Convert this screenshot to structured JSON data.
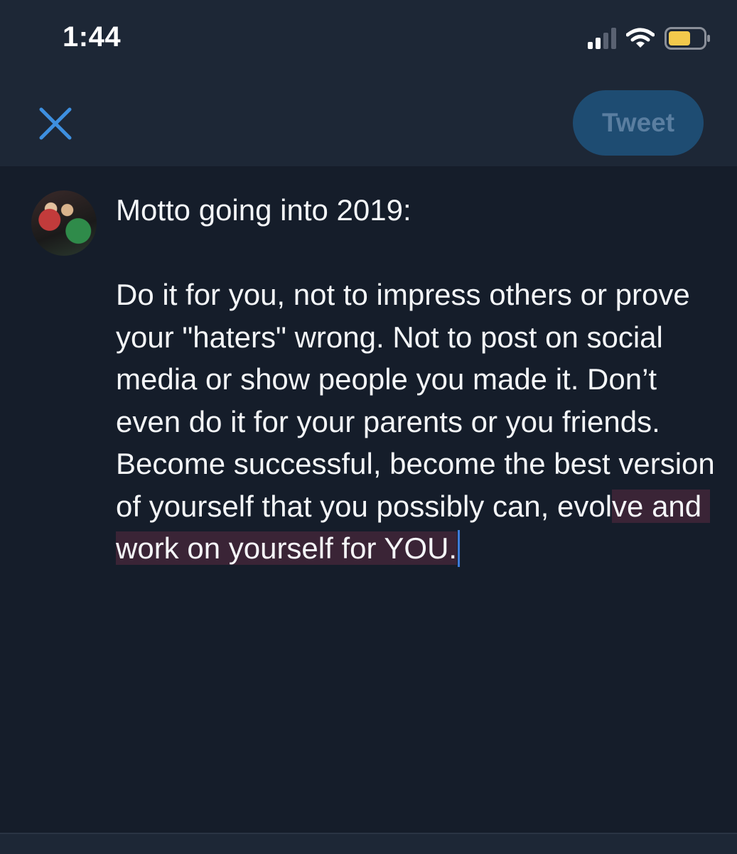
{
  "status_bar": {
    "time": "1:44",
    "icons": [
      "cellular-signal-icon",
      "wifi-icon",
      "battery-icon"
    ],
    "battery_color": "#f2c94c"
  },
  "header": {
    "close_icon": "close-icon",
    "tweet_label": "Tweet",
    "tweet_enabled": false
  },
  "compose": {
    "line1": "Motto going into 2019:",
    "body_before": "Do it for you, not to impress others or prove your \"haters\" wrong. Not to post on social media or show people you made it. Don’t even do it for your parents or you friends. Become successful, become the best version of yourself that you possibly can, evol",
    "body_highlighted": "ve and work on yourself for YOU."
  },
  "colors": {
    "background": "#151d2a",
    "header_background": "#1d2736",
    "accent": "#3d8fe0",
    "tweet_button_bg": "#1e4c72",
    "highlight": "#3a2436"
  }
}
